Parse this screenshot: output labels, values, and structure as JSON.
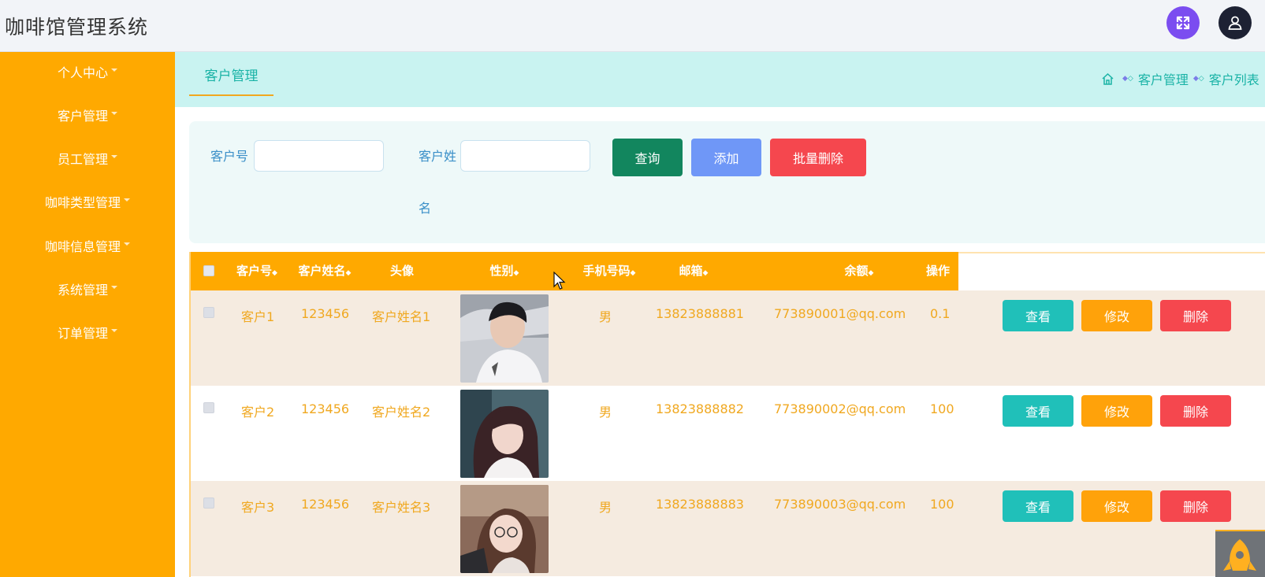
{
  "app": {
    "title": "咖啡馆管理系统"
  },
  "header": {
    "fullscreen_icon": "fullscreen-icon",
    "user_icon": "user-icon"
  },
  "sidebar": {
    "items": [
      {
        "label": "个人中心"
      },
      {
        "label": "客户管理"
      },
      {
        "label": "员工管理"
      },
      {
        "label": "咖啡类型管理"
      },
      {
        "label": "咖啡信息管理"
      },
      {
        "label": "系统管理"
      },
      {
        "label": "订单管理"
      }
    ]
  },
  "tabs": {
    "active": "客户管理"
  },
  "breadcrumb": {
    "home_icon": "home-icon",
    "level1": "客户管理",
    "level2": "客户列表"
  },
  "search": {
    "customer_no_label": "客户号",
    "customer_name_label_line1": "客户姓",
    "customer_name_label_line2": "名",
    "customer_no_value": "",
    "customer_name_value": "",
    "query_button": "查询",
    "add_button": "添加",
    "batch_delete_button": "批量删除"
  },
  "table": {
    "headers": {
      "customer_no": "客户号",
      "customer_name": "客户姓名",
      "avatar": "头像",
      "gender": "性别",
      "phone": "手机号码",
      "email": "邮箱",
      "balance": "余额",
      "actions": "操作"
    },
    "rows": [
      {
        "customer_no": "客户1",
        "password": "123456",
        "customer_name": "客户姓名1",
        "gender": "男",
        "phone": "13823888881",
        "email": "773890001@qq.com",
        "balance": "0.1",
        "view": "查看",
        "edit": "修改",
        "delete": "删除"
      },
      {
        "customer_no": "客户2",
        "password": "123456",
        "customer_name": "客户姓名2",
        "gender": "男",
        "phone": "13823888882",
        "email": "773890002@qq.com",
        "balance": "100",
        "view": "查看",
        "edit": "修改",
        "delete": "删除"
      },
      {
        "customer_no": "客户3",
        "password": "123456",
        "customer_name": "客户姓名3",
        "gender": "男",
        "phone": "13823888883",
        "email": "773890003@qq.com",
        "balance": "100",
        "view": "查看",
        "edit": "修改",
        "delete": "删除"
      }
    ]
  },
  "colors": {
    "sidebar_bg": "#ffa900",
    "tabbar_bg": "#c9f3f1",
    "accent_teal": "#1ab3a6",
    "query_btn": "#12865e",
    "add_btn": "#6f97f7",
    "delete_btn": "#f5474e",
    "view_btn": "#20c0b9",
    "edit_btn": "#ffa20a",
    "row_text": "#f0a820"
  }
}
